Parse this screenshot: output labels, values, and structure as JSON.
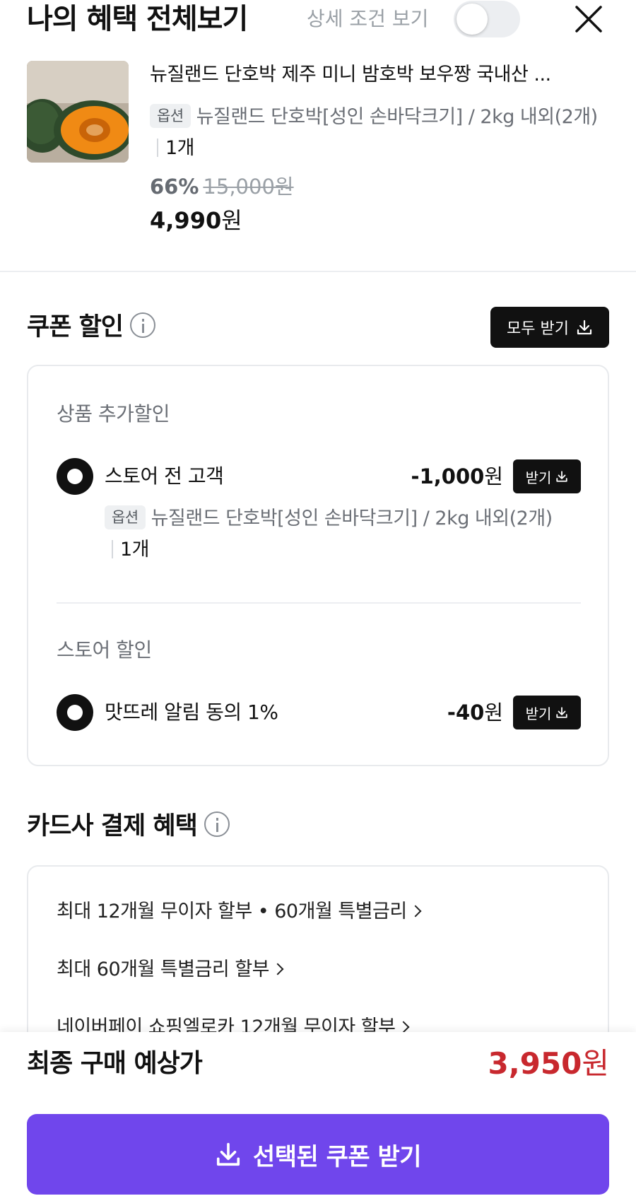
{
  "header": {
    "title": "나의 혜택 전체보기",
    "detail_toggle_label": "상세 조건 보기",
    "detail_toggle_on": false
  },
  "product": {
    "name": "뉴질랜드 단호박 제주 미니 밤호박 보우짱 국내산 ...",
    "option_badge": "옵션",
    "option_text": "뉴질랜드 단호박[성인 손바닥크기] / 2kg 내외(2개)",
    "quantity": "1개",
    "discount_rate": "66%",
    "original_price": "15,000원",
    "final_price_number": "4,990",
    "final_price_unit": "원"
  },
  "coupon_section": {
    "title": "쿠폰 할인",
    "get_all_label": "모두 받기",
    "groups": [
      {
        "subtitle": "상품 추가할인",
        "coupon_name": "스토어 전 고객",
        "amount_number": "-1,000",
        "amount_unit": "원",
        "receive_label": "받기",
        "option_badge": "옵션",
        "option_text": "뉴질랜드 단호박[성인 손바닥크기] / 2kg 내외(2개)",
        "quantity": "1개"
      },
      {
        "subtitle": "스토어 할인",
        "coupon_name": "맛뜨레 알림 동의 1%",
        "amount_number": "-40",
        "amount_unit": "원",
        "receive_label": "받기"
      }
    ]
  },
  "card_section": {
    "title": "카드사 결제 혜택",
    "items": [
      "최대 12개월 무이자 할부 • 60개월 특별금리",
      "최대 60개월 특별금리 할부",
      "네이버페이 쇼핑엘로카 12개월 무이자 할부"
    ]
  },
  "bottom": {
    "total_label": "최종 구매 예상가",
    "total_number": "3,950",
    "total_unit": "원",
    "cta_label": "선택된 쿠폰 받기"
  },
  "colors": {
    "accent_purple": "#7046ec",
    "price_red": "#c8282e",
    "button_black": "#111111"
  }
}
